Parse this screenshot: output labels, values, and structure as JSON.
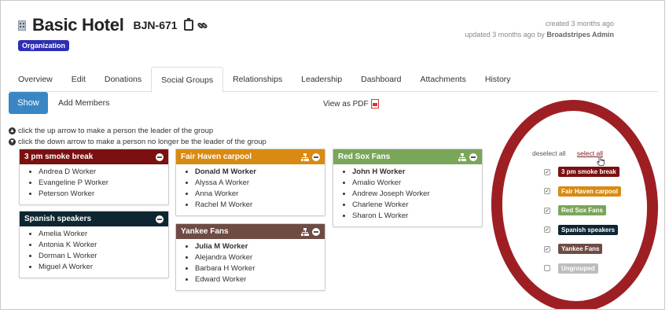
{
  "header": {
    "title": "Basic Hotel",
    "code": "BJN-671",
    "badge": "Organization",
    "created": "created 3 months ago",
    "updated_prefix": "updated 3 months ago by ",
    "updated_by": "Broadstripes Admin"
  },
  "tabs": [
    "Overview",
    "Edit",
    "Donations",
    "Social Groups",
    "Relationships",
    "Leadership",
    "Dashboard",
    "Attachments",
    "History"
  ],
  "active_tab": "Social Groups",
  "toolbar": {
    "show_label": "Show",
    "add_members_label": "Add Members",
    "view_pdf_label": "View as PDF"
  },
  "hints": [
    "click the up arrow to make a person the leader of the group",
    "click the down arrow to make a person no longer be the leader of the group"
  ],
  "groups": [
    {
      "name": "3 pm smoke break",
      "color": "#7a1010",
      "members": [
        "Andrea D Worker",
        "Evangeline P Worker",
        "Peterson Worker"
      ]
    },
    {
      "name": "Fair Haven carpool",
      "color": "#d98a12",
      "members": [
        "Donald M Worker",
        "Alyssa A Worker",
        "Anna Worker",
        "Rachel M Worker"
      ]
    },
    {
      "name": "Red Sox Fans",
      "color": "#7aa65a",
      "members": [
        "John H Worker",
        "Amalio Worker",
        "Andrew Joseph Worker",
        "Charlene Worker",
        "Sharon L Worker"
      ]
    },
    {
      "name": "Spanish speakers",
      "color": "#0d2631",
      "members": [
        "Amelia Worker",
        "Antonia K Worker",
        "Dorman L Worker",
        "Miguel A Worker"
      ]
    },
    {
      "name": "Yankee Fans",
      "color": "#6e4b43",
      "members": [
        "Julia M Worker",
        "Alejandra Worker",
        "Barbara H Worker",
        "Edward Worker"
      ]
    }
  ],
  "filter": {
    "deselect_all": "deselect all",
    "select_all": "select all",
    "items": [
      {
        "label": "3 pm smoke break",
        "color": "#7a1010",
        "checked": "✓"
      },
      {
        "label": "Fair Haven carpool",
        "color": "#d98a12",
        "checked": "✓"
      },
      {
        "label": "Red Sox Fans",
        "color": "#7aa65a",
        "checked": "✓"
      },
      {
        "label": "Spanish speakers",
        "color": "#0d2631",
        "checked": "✓"
      },
      {
        "label": "Yankee Fans",
        "color": "#6e4b43",
        "checked": "✓"
      },
      {
        "label": "Ungrouped",
        "color": "#bdbdbd",
        "checked": ""
      }
    ]
  }
}
